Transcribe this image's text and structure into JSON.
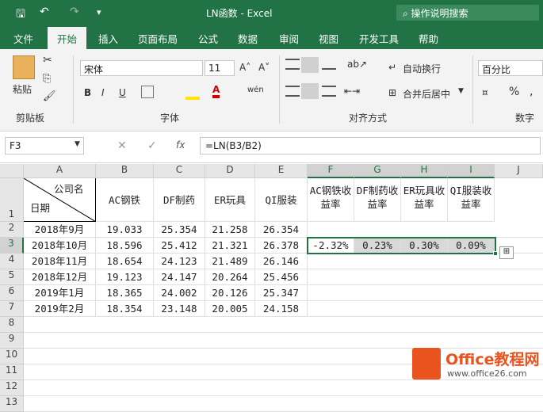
{
  "window": {
    "title": "LN函数 - Excel",
    "tellme": "操作说明搜索"
  },
  "qat": {
    "save": "🖫",
    "undo": "↶",
    "redo": "↷",
    "customize": "▾"
  },
  "menu": [
    "文件",
    "开始",
    "插入",
    "页面布局",
    "公式",
    "数据",
    "审阅",
    "视图",
    "开发工具",
    "帮助"
  ],
  "ribbon": {
    "clipboard": {
      "label": "剪贴板",
      "paste": "粘贴"
    },
    "font": {
      "label": "字体",
      "name": "宋体",
      "size": "11",
      "bold": "B",
      "italic": "I",
      "underline": "U"
    },
    "align": {
      "label": "对齐方式",
      "wrap": "自动换行",
      "merge": "合并后居中"
    },
    "number": {
      "label": "数字",
      "format": "百分比",
      "pct": "%"
    }
  },
  "formula_bar": {
    "namebox": "F3",
    "fx": "fx",
    "formula": "=LN(B3/B2)"
  },
  "columns": [
    "A",
    "B",
    "C",
    "D",
    "E",
    "F",
    "G",
    "H",
    "I",
    "J"
  ],
  "rows": [
    "1",
    "2",
    "3",
    "4",
    "5",
    "6",
    "7",
    "8",
    "9",
    "10",
    "11",
    "12",
    "13"
  ],
  "header": {
    "a1_top": "公司名",
    "a1_bottom": "日期",
    "b": "AC钢铁",
    "c": "DF制药",
    "d": "ER玩具",
    "e": "QI服装",
    "f": "AC钢铁收益率",
    "g": "DF制药收益率",
    "h": "ER玩具收益率",
    "i": "QI服装收益率"
  },
  "table": [
    [
      "2018年9月",
      "19.033",
      "25.354",
      "21.258",
      "26.354"
    ],
    [
      "2018年10月",
      "18.596",
      "25.412",
      "21.321",
      "26.378"
    ],
    [
      "2018年11月",
      "18.654",
      "24.123",
      "21.489",
      "26.146"
    ],
    [
      "2018年12月",
      "19.123",
      "24.147",
      "20.264",
      "25.456"
    ],
    [
      "2019年1月",
      "18.365",
      "24.002",
      "20.126",
      "25.347"
    ],
    [
      "2019年2月",
      "18.354",
      "23.148",
      "20.005",
      "24.158"
    ]
  ],
  "returns": [
    "-2.32%",
    "0.23%",
    "0.30%",
    "0.09%"
  ],
  "watermark": {
    "brand": "Office教程网",
    "url": "www.office26.com"
  }
}
